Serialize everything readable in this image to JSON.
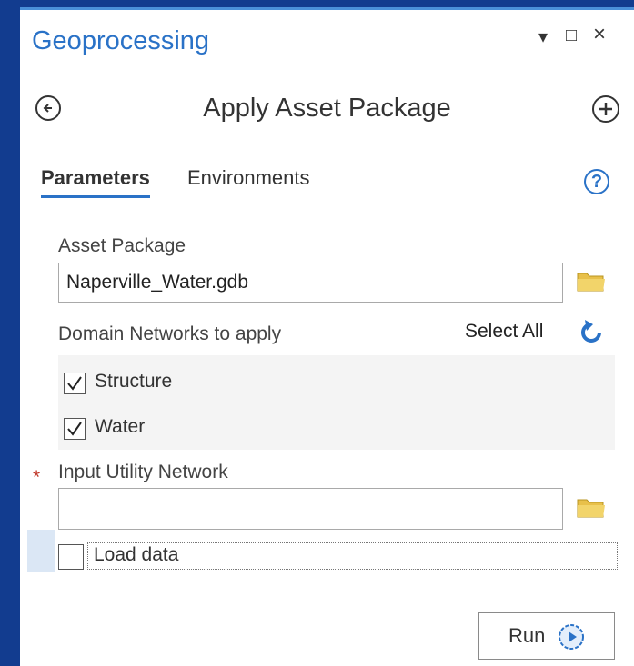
{
  "pane": {
    "title": "Geoprocessing",
    "controls": {
      "menu": "▾",
      "maximize": "□",
      "close": "×"
    }
  },
  "tool": {
    "title": "Apply Asset Package"
  },
  "tabs": {
    "parameters": "Parameters",
    "environments": "Environments"
  },
  "params": {
    "asset_package": {
      "label": "Asset Package",
      "value": "Naperville_Water.gdb"
    },
    "domain_networks": {
      "label": "Domain Networks to apply",
      "select_all": "Select All",
      "items": [
        {
          "label": "Structure",
          "checked": true
        },
        {
          "label": "Water",
          "checked": true
        }
      ]
    },
    "input_utility_network": {
      "label": "Input Utility Network",
      "value": "",
      "required_mark": "*"
    },
    "load_data": {
      "label": "Load data",
      "checked": false
    }
  },
  "run": {
    "label": "Run"
  },
  "colors": {
    "accent": "#2a72c7",
    "required": "#c0392b",
    "folder": "#e8c04a"
  },
  "icons": [
    "back-arrow-icon",
    "add-circle-icon",
    "help-icon",
    "folder-icon",
    "refresh-icon",
    "run-play-icon",
    "check-icon"
  ]
}
